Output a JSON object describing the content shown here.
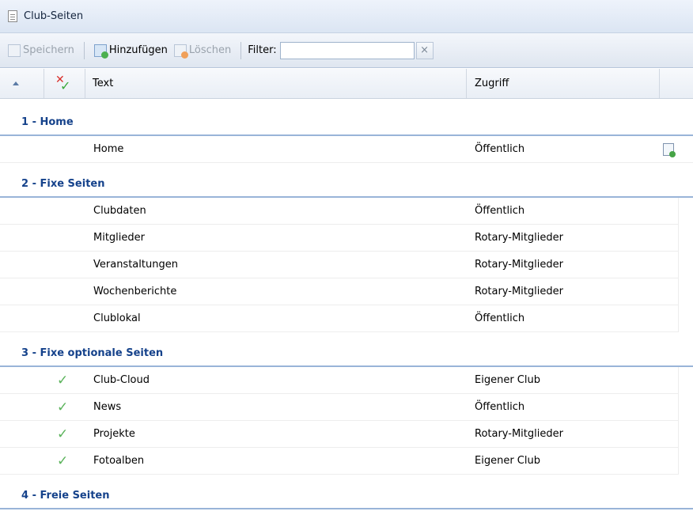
{
  "window": {
    "title": "Club-Seiten"
  },
  "toolbar": {
    "save_label": "Speichern",
    "add_label": "Hinzufügen",
    "delete_label": "Löschen",
    "filter_label": "Filter:",
    "filter_value": "",
    "clear_label": "×"
  },
  "grid": {
    "columns": {
      "text": "Text",
      "access": "Zugriff"
    },
    "groups": [
      {
        "label": "1 - Home",
        "rows": [
          {
            "text": "Home",
            "access": "Öffentlich",
            "checked": false,
            "has_action_icon": true
          }
        ]
      },
      {
        "label": "2 - Fixe Seiten",
        "rows": [
          {
            "text": "Clubdaten",
            "access": "Öffentlich",
            "checked": false
          },
          {
            "text": "Mitglieder",
            "access": "Rotary-Mitglieder",
            "checked": false
          },
          {
            "text": "Veranstaltungen",
            "access": "Rotary-Mitglieder",
            "checked": false
          },
          {
            "text": "Wochenberichte",
            "access": "Rotary-Mitglieder",
            "checked": false
          },
          {
            "text": "Clublokal",
            "access": "Öffentlich",
            "checked": false
          }
        ]
      },
      {
        "label": "3 - Fixe optionale Seiten",
        "rows": [
          {
            "text": "Club-Cloud",
            "access": "Eigener Club",
            "checked": true
          },
          {
            "text": "News",
            "access": "Öffentlich",
            "checked": true
          },
          {
            "text": "Projekte",
            "access": "Rotary-Mitglieder",
            "checked": true
          },
          {
            "text": "Fotoalben",
            "access": "Eigener Club",
            "checked": true
          }
        ]
      },
      {
        "label": "4 - Freie Seiten",
        "rows": []
      }
    ]
  },
  "icons": {
    "title": "document-icon",
    "save": "save-icon",
    "add": "add-page-icon",
    "delete": "delete-page-icon",
    "sort": "sort-ascending-icon",
    "status": "status-check-icon",
    "row_check": "check-icon",
    "row_action": "open-page-icon"
  },
  "colors": {
    "group_text": "#15428b",
    "group_line": "#99b4d8",
    "check": "#5bb35b",
    "cross": "#d9302c"
  }
}
